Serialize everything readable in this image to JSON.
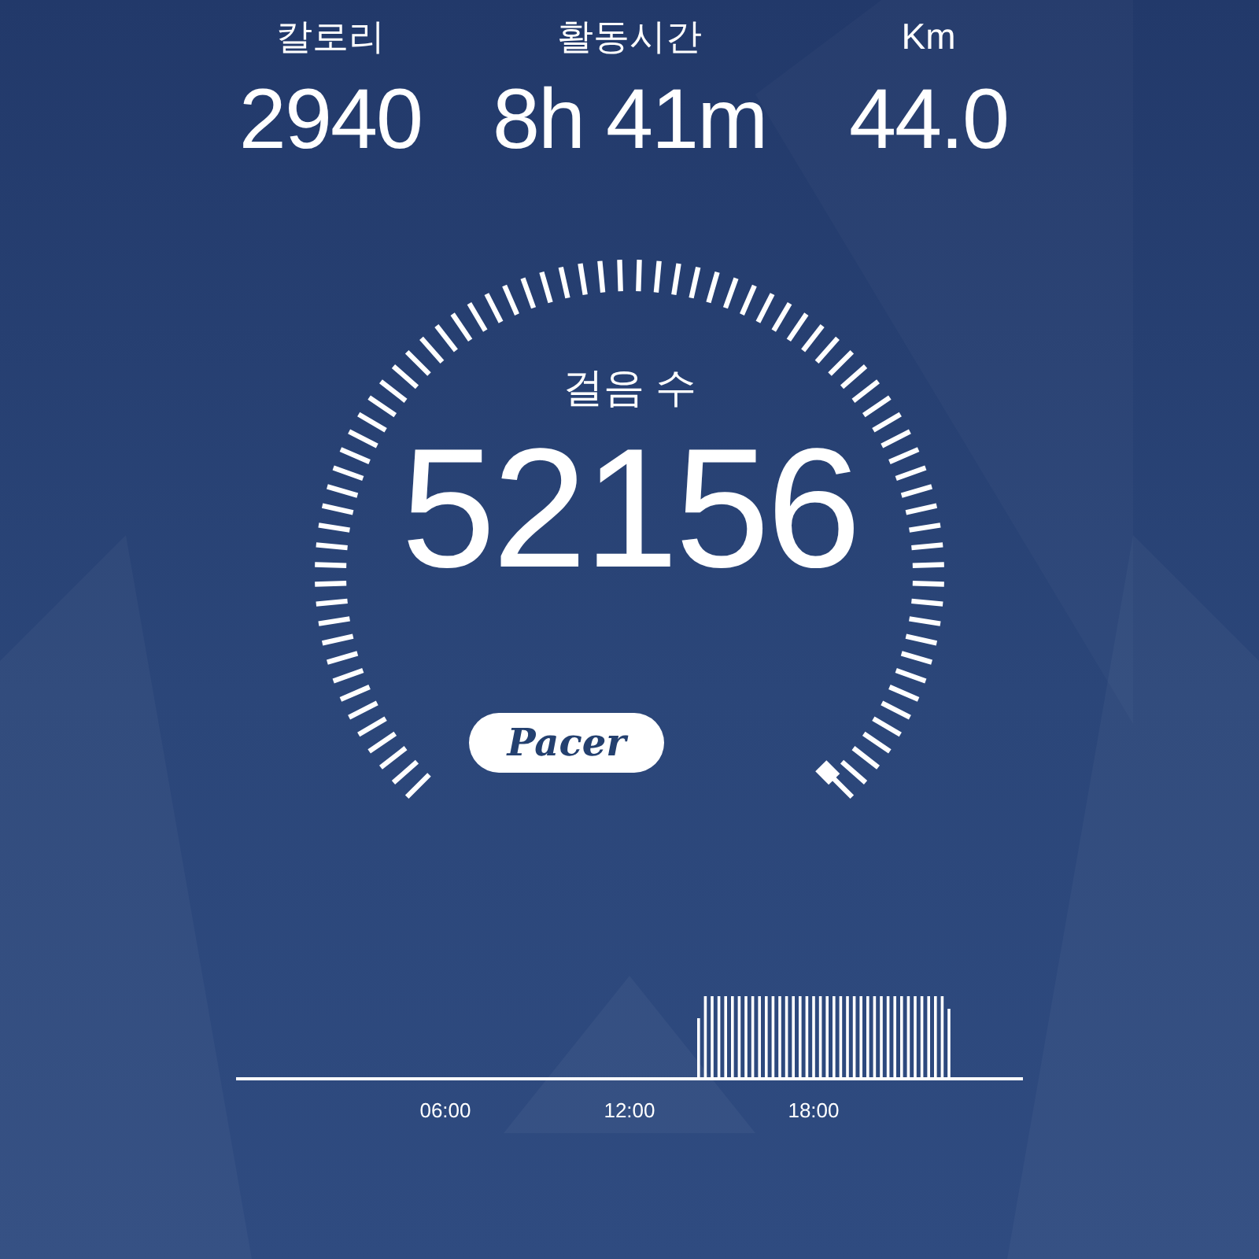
{
  "stats": [
    {
      "label": "칼로리",
      "value": "2940"
    },
    {
      "label": "활동시간",
      "value": "8h 41m"
    },
    {
      "label": "Km",
      "value": "44.0"
    }
  ],
  "gauge": {
    "label": "걸음 수",
    "value": "52156"
  },
  "logo": "Pacer",
  "timeline": {
    "labels": [
      "06:00",
      "12:00",
      "18:00"
    ]
  }
}
